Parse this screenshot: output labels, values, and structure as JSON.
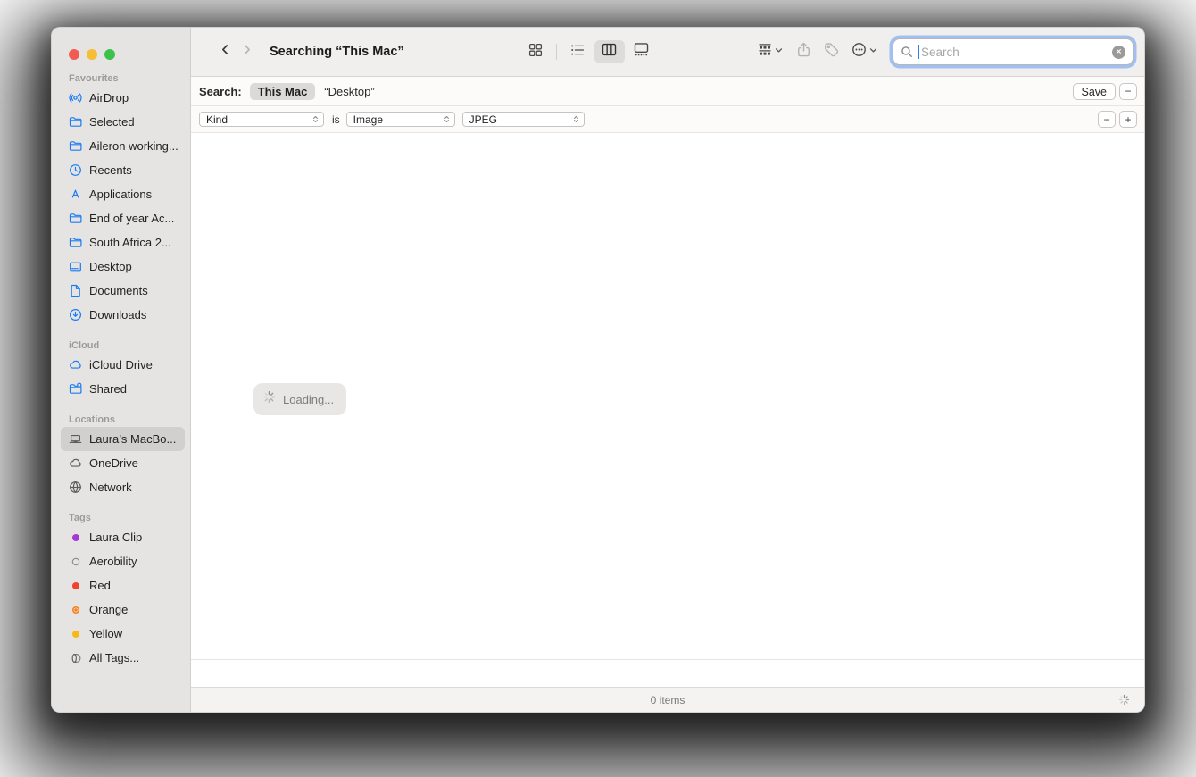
{
  "window": {
    "title": "Searching “This Mac”"
  },
  "sidebar": {
    "sections": [
      {
        "title": "Favourites",
        "items": [
          {
            "label": "AirDrop",
            "icon": "airdrop"
          },
          {
            "label": "Selected",
            "icon": "folder"
          },
          {
            "label": "Aileron working...",
            "icon": "folder"
          },
          {
            "label": "Recents",
            "icon": "clock"
          },
          {
            "label": "Applications",
            "icon": "appstore"
          },
          {
            "label": "End of year Ac...",
            "icon": "folder"
          },
          {
            "label": "South Africa 2...",
            "icon": "folder"
          },
          {
            "label": "Desktop",
            "icon": "desktop"
          },
          {
            "label": "Documents",
            "icon": "document"
          },
          {
            "label": "Downloads",
            "icon": "download"
          }
        ]
      },
      {
        "title": "iCloud",
        "items": [
          {
            "label": "iCloud Drive",
            "icon": "cloud"
          },
          {
            "label": "Shared",
            "icon": "shared-folder"
          }
        ]
      },
      {
        "title": "Locations",
        "items": [
          {
            "label": "Laura’s MacBo...",
            "icon": "laptop",
            "gray": true,
            "selected": true
          },
          {
            "label": "OneDrive",
            "icon": "cloud",
            "gray": true
          },
          {
            "label": "Network",
            "icon": "globe",
            "gray": true
          }
        ]
      },
      {
        "title": "Tags",
        "items": [
          {
            "label": "Laura Clip",
            "icon": "dot",
            "dot_color": "#a43ad2"
          },
          {
            "label": "Aerobility",
            "icon": "dot-outline"
          },
          {
            "label": "Red",
            "icon": "dot",
            "dot_color": "#f0422c"
          },
          {
            "label": "Orange",
            "icon": "dot-dotted",
            "dot_color": "#f58220"
          },
          {
            "label": "Yellow",
            "icon": "dot",
            "dot_color": "#f7b918"
          },
          {
            "label": "All Tags...",
            "icon": "all-tags",
            "gray": true
          }
        ]
      }
    ]
  },
  "search": {
    "placeholder": "Search"
  },
  "scope": {
    "label": "Search:",
    "this_mac": "This Mac",
    "desktop": "“Desktop”",
    "save": "Save",
    "minus": "−"
  },
  "filters": {
    "dropdowns": [
      "Kind",
      "Image",
      "JPEG"
    ],
    "connector": "is",
    "minus": "−",
    "plus": "+"
  },
  "content": {
    "loading": "Loading..."
  },
  "status": {
    "count": "0 items"
  },
  "colors": {
    "accent_blue": "#1a7cf4",
    "focus_ring": "#6da0f3",
    "sidebar_bg": "#e6e4e2",
    "toolbar_bg": "#f1efee",
    "selected_pill": "#d2d0ce",
    "traffic_red": "#f35b51",
    "traffic_yellow": "#f6be35",
    "traffic_green": "#3ac24b"
  }
}
